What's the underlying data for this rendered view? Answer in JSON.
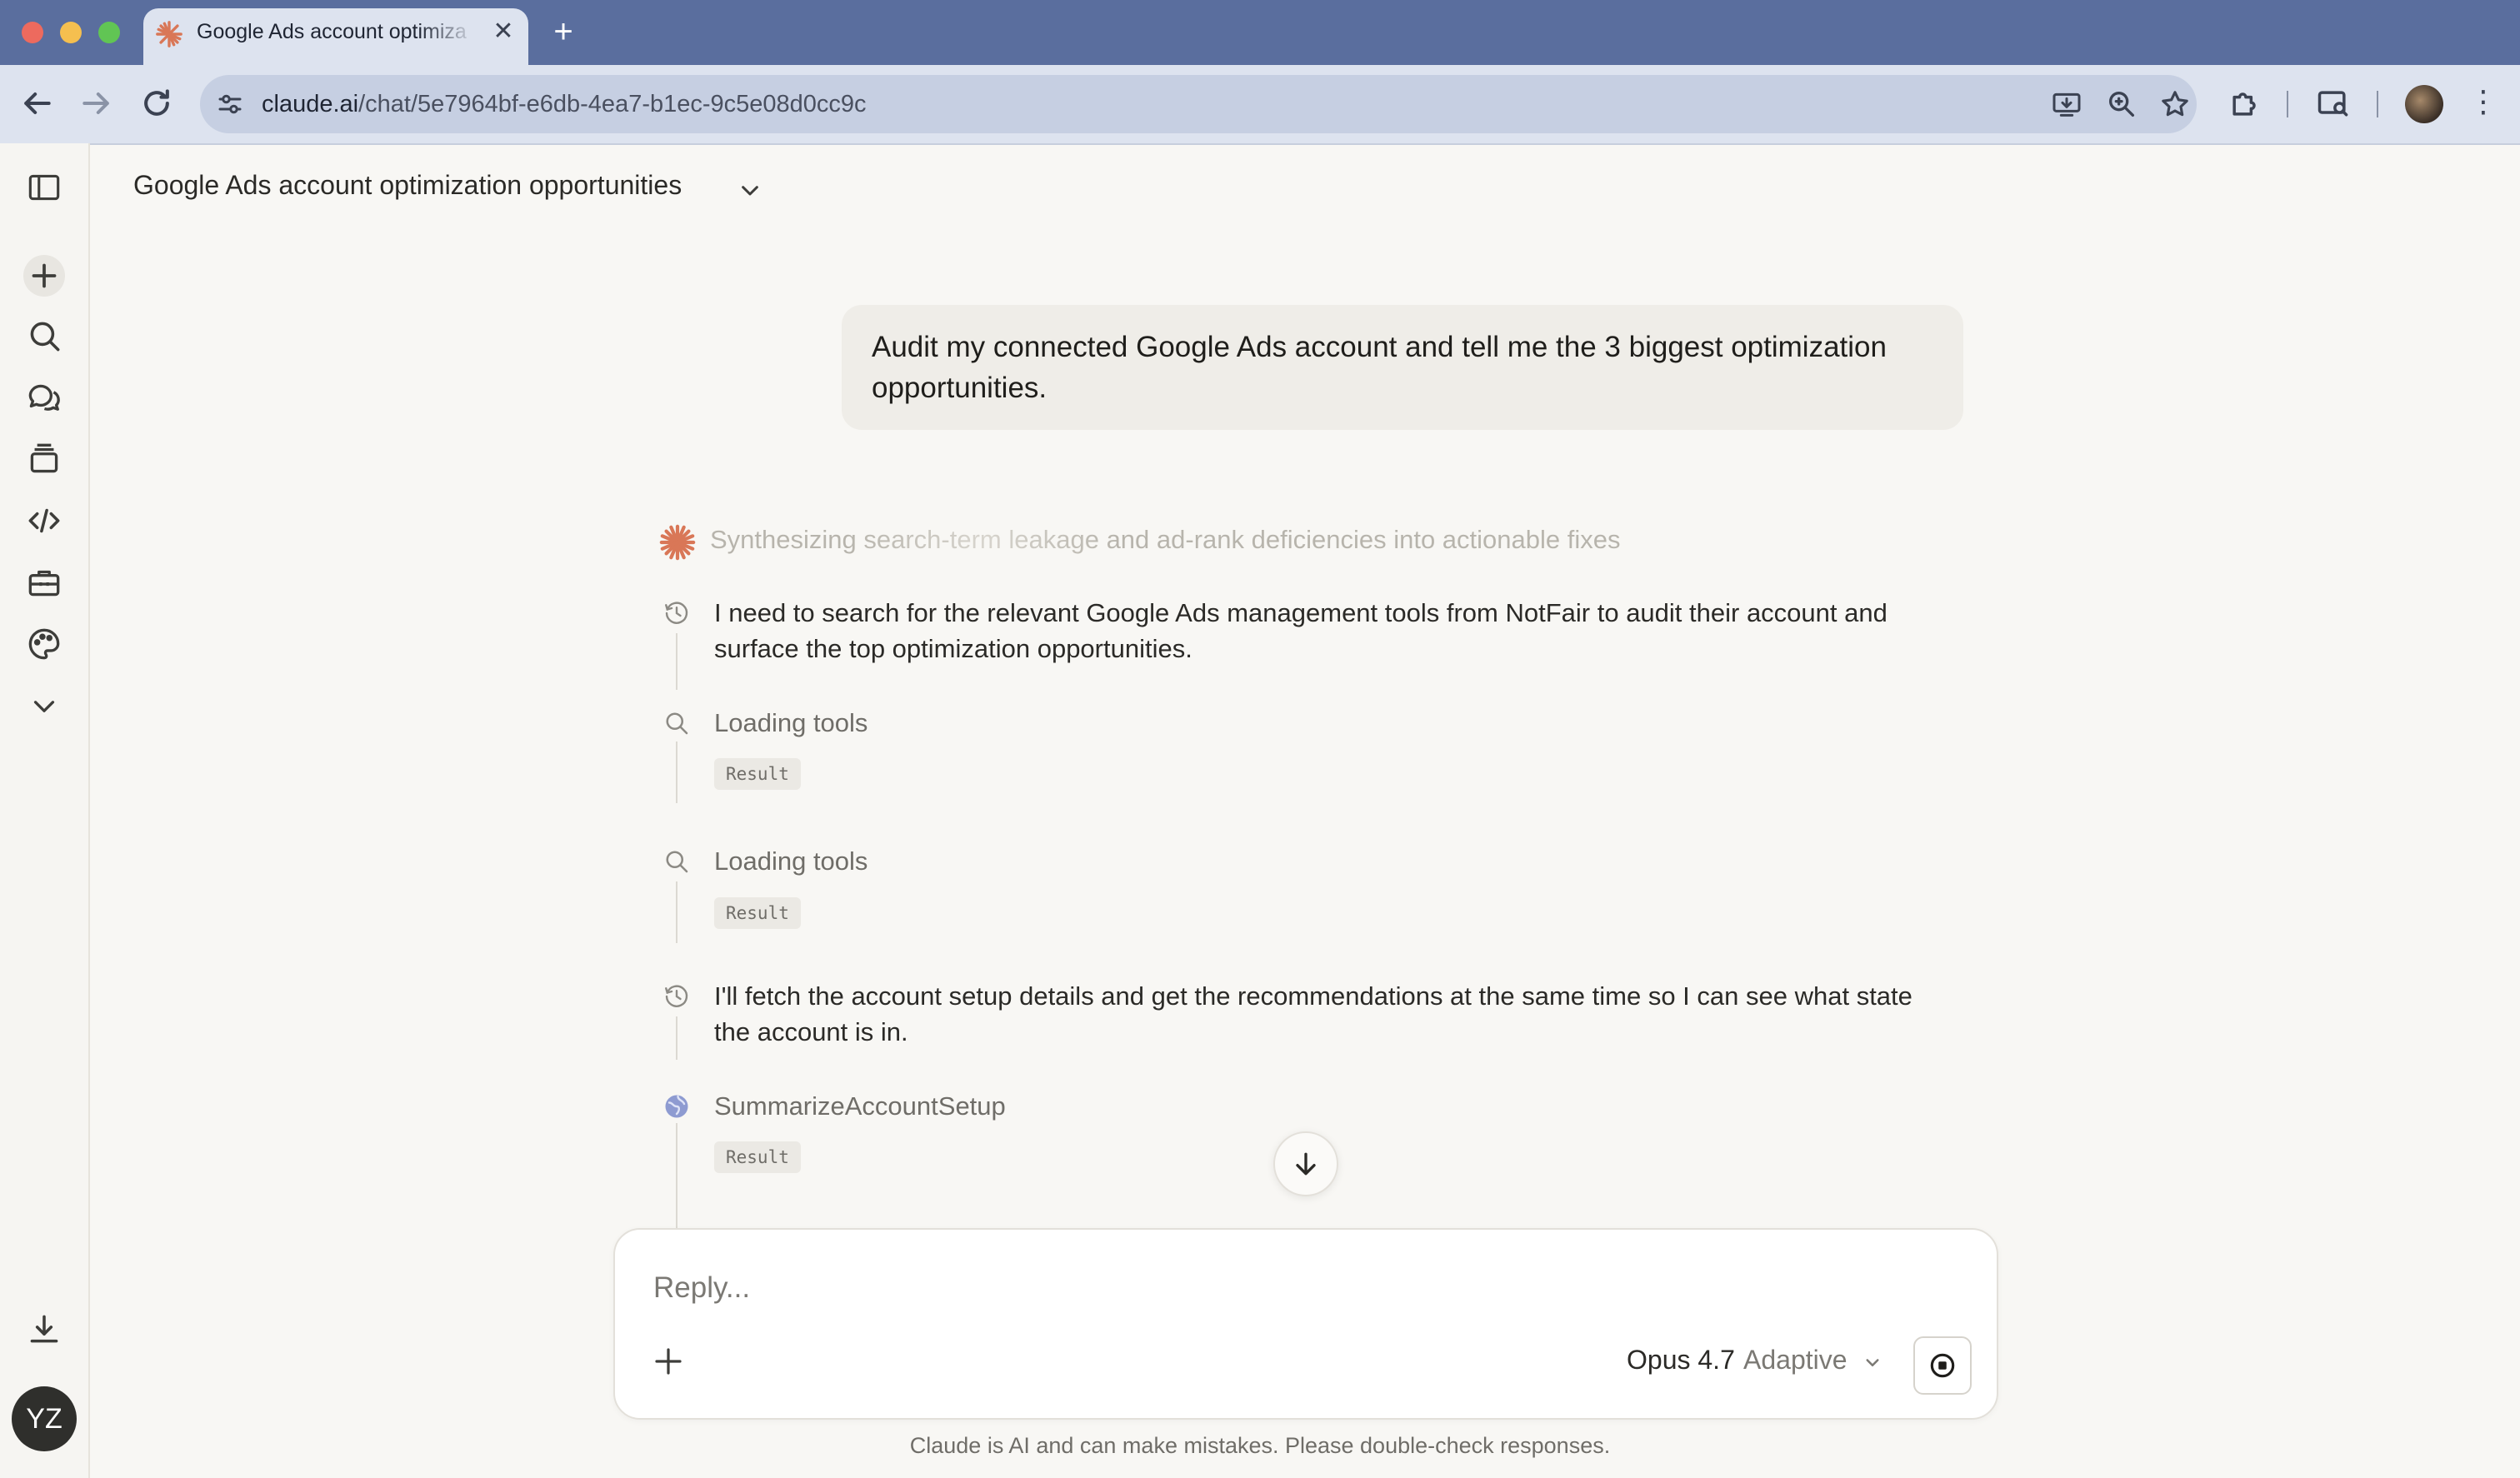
{
  "browser": {
    "tab_title": "Google Ads account optimiza",
    "new_tab": "+",
    "url_host": "claude.ai",
    "url_path": "/chat/5e7964bf-e6db-4ea7-b1ec-9c5e08d0cc9c"
  },
  "chat": {
    "title": "Google Ads account optimization opportunities",
    "user_message": "Audit my connected Google Ads account and tell me the 3 biggest optimization opportunities.",
    "status": "Synthesizing search-term leakage and ad-rank deficiencies into actionable fixes",
    "steps": [
      {
        "type": "thought",
        "text": "I need to search for the relevant Google Ads management tools from NotFair to audit their account and surface the top optimization opportunities."
      },
      {
        "type": "tool",
        "label": "Loading tools",
        "result": "Result"
      },
      {
        "type": "tool",
        "label": "Loading tools",
        "result": "Result"
      },
      {
        "type": "thought",
        "text": "I'll fetch the account setup details and get the recommendations at the same time so I can see what state the account is in."
      },
      {
        "type": "tool",
        "label": "SummarizeAccountSetup",
        "result": "Result"
      }
    ]
  },
  "composer": {
    "placeholder": "Reply...",
    "model": "Opus 4.7",
    "mode": "Adaptive"
  },
  "footer": {
    "disclaimer": "Claude is AI and can make mistakes. Please double-check responses."
  },
  "user": {
    "initials": "YZ"
  },
  "colors": {
    "accent": "#d97757",
    "background": "#f8f7f4",
    "browser_frame": "#5a6e9e"
  }
}
